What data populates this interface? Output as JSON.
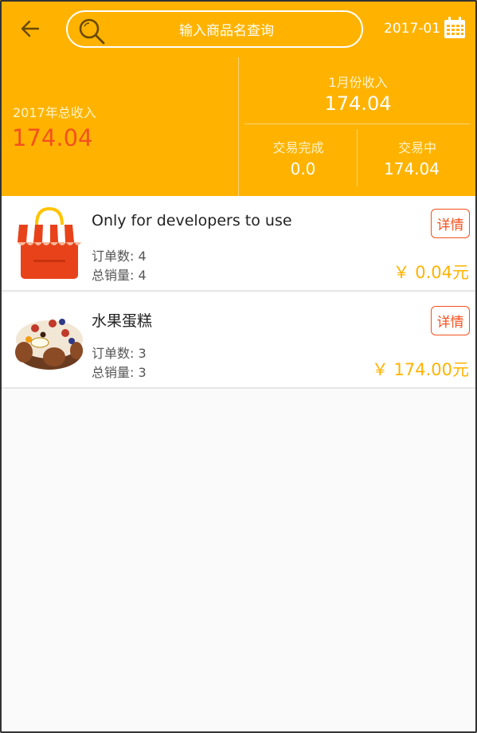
{
  "header": {
    "search_placeholder": "输入商品名查询",
    "date": "2017-01"
  },
  "summary": {
    "year_label": "2017年总收入",
    "year_value": "174.04",
    "month_label": "1月份收入",
    "month_value": "174.04",
    "completed_label": "交易完成",
    "completed_value": "0.0",
    "pending_label": "交易中",
    "pending_value": "174.04"
  },
  "products": [
    {
      "name": "Only for developers to use",
      "orders": "订单数: 4",
      "sales": "总销量: 4",
      "price": "￥ 0.04元",
      "detail_label": "详情",
      "icon": "shop-icon"
    },
    {
      "name": "水果蛋糕",
      "orders": "订单数: 3",
      "sales": "总销量: 3",
      "price": "￥ 174.00元",
      "detail_label": "详情",
      "icon": "cake-image"
    }
  ],
  "colors": {
    "accent": "#ffb300",
    "highlight": "#f4511e"
  }
}
